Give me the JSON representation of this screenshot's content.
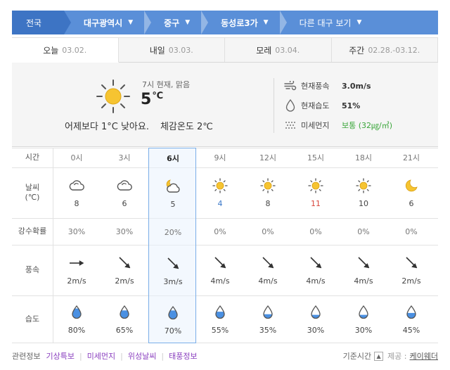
{
  "breadcrumb": {
    "items": [
      {
        "label": "전국",
        "arrow": ""
      },
      {
        "label": "대구광역시",
        "arrow": "▼"
      },
      {
        "label": "중구",
        "arrow": "▼"
      },
      {
        "label": "동성로3가",
        "arrow": "▼"
      },
      {
        "label": "다른 대구 보기",
        "arrow": "▼"
      }
    ]
  },
  "tabs": [
    {
      "label": "오늘",
      "date": "03.02."
    },
    {
      "label": "내일",
      "date": "03.03."
    },
    {
      "label": "모레",
      "date": "03.04."
    },
    {
      "label": "주간",
      "date": "02.28.-03.12."
    }
  ],
  "current": {
    "condition": "7시 현재, 맑음",
    "temp": "5",
    "unit": "℃",
    "compare": "어제보다 1°C 낮아요.",
    "feels": "체감온도 2℃",
    "wind_label": "현재풍속",
    "wind_value": "3.0m/s",
    "humidity_label": "현재습도",
    "humidity_value": "51%",
    "dust_label": "미세먼지",
    "dust_value": "보통 (32㎍/㎥)",
    "color_good": "#3aa63a"
  },
  "row_labels": {
    "time": "시간",
    "weather": "날씨",
    "weather_unit": "(℃)",
    "pop": "강수확률",
    "wind": "풍속",
    "hum": "습도"
  },
  "hours": [
    {
      "time": "0시",
      "icon": "cloud-icon",
      "temp": "8",
      "pop": "30%",
      "wind_dir": "east-arrow-icon",
      "wind": "2m/s",
      "hum": "80%",
      "hum_level": 0.8
    },
    {
      "time": "3시",
      "icon": "cloud-icon",
      "temp": "6",
      "pop": "30%",
      "wind_dir": "southeast-arrow-icon",
      "wind": "2m/s",
      "hum": "65%",
      "hum_level": 0.65
    },
    {
      "time": "6시",
      "icon": "moon-cloud-icon",
      "temp": "5",
      "pop": "20%",
      "wind_dir": "southeast-arrow-icon",
      "wind": "3m/s",
      "hum": "70%",
      "hum_level": 0.7
    },
    {
      "time": "9시",
      "icon": "sun-icon",
      "temp": "4",
      "pop": "0%",
      "wind_dir": "southeast-arrow-icon",
      "wind": "4m/s",
      "hum": "55%",
      "hum_level": 0.55
    },
    {
      "time": "12시",
      "icon": "sun-icon",
      "temp": "8",
      "pop": "0%",
      "wind_dir": "southeast-arrow-icon",
      "wind": "4m/s",
      "hum": "35%",
      "hum_level": 0.35
    },
    {
      "time": "15시",
      "icon": "sun-icon",
      "temp": "11",
      "pop": "0%",
      "wind_dir": "southeast-arrow-icon",
      "wind": "4m/s",
      "hum": "30%",
      "hum_level": 0.3
    },
    {
      "time": "18시",
      "icon": "sun-icon",
      "temp": "10",
      "pop": "0%",
      "wind_dir": "southeast-arrow-icon",
      "wind": "4m/s",
      "hum": "30%",
      "hum_level": 0.3
    },
    {
      "time": "21시",
      "icon": "moon-icon",
      "temp": "6",
      "pop": "0%",
      "wind_dir": "southeast-arrow-icon",
      "wind": "2m/s",
      "hum": "45%",
      "hum_level": 0.45
    }
  ],
  "selected_hour": "6시",
  "footer": {
    "related": "관련정보",
    "links": [
      "기상특보",
      "미세먼지",
      "위성날씨",
      "태풍정보"
    ],
    "basetime": "기준시간",
    "source_label": "제공 :",
    "source": "케이웨더"
  },
  "colors": {
    "breadcrumb": "#5a8fd8",
    "breadcrumb_first": "#3d74c4",
    "low_temp": "#3a78c9",
    "high_temp": "#d9453b",
    "sun": "#f6c431",
    "water": "#4a90e2",
    "link": "#8a3fbf"
  }
}
